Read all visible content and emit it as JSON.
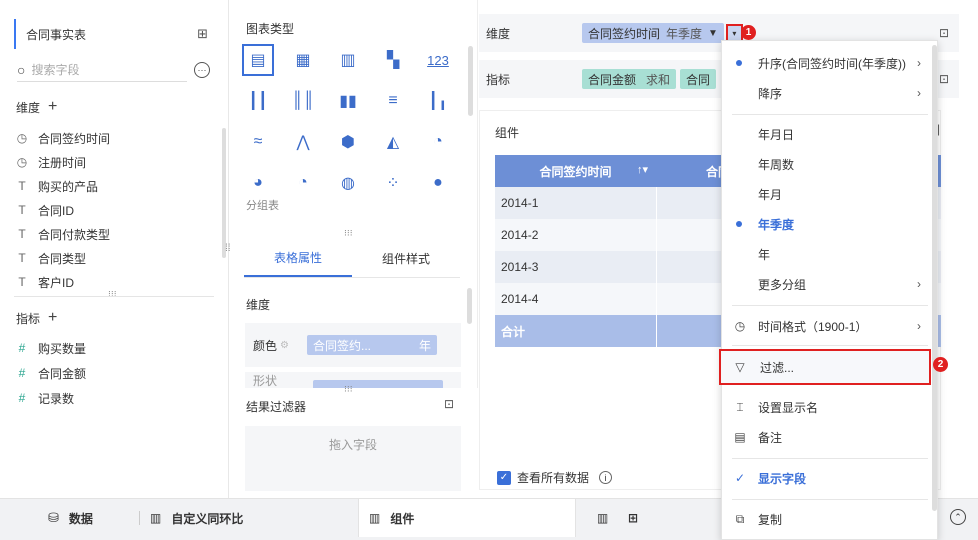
{
  "left": {
    "dataset": "合同事实表",
    "search_placeholder": "搜索字段",
    "dim_title": "维度",
    "dims": [
      {
        "icon": "clock",
        "label": "合同签约时间"
      },
      {
        "icon": "clock",
        "label": "注册时间"
      },
      {
        "icon": "text",
        "label": "购买的产品"
      },
      {
        "icon": "text",
        "label": "合同ID"
      },
      {
        "icon": "text",
        "label": "合同付款类型"
      },
      {
        "icon": "text",
        "label": "合同类型"
      },
      {
        "icon": "text",
        "label": "客户ID"
      }
    ],
    "measure_title": "指标",
    "measures": [
      {
        "label": "购买数量"
      },
      {
        "label": "合同金额"
      },
      {
        "label": "记录数"
      }
    ]
  },
  "mid": {
    "chart_type_title": "图表类型",
    "group_label": "分组表",
    "tabs": [
      "表格属性",
      "组件样式"
    ],
    "dim_label": "维度",
    "color_label": "颜色",
    "color_field": "合同签约...",
    "color_suffix": "年",
    "shape_label": "形状",
    "filter_title": "结果过滤器",
    "drop_hint": "拖入字段"
  },
  "right": {
    "dim_label": "维度",
    "dim_pill": "合同签约时间",
    "dim_pill_sub": "年季度",
    "measure_label": "指标",
    "measure_pill": "合同金额",
    "measure_pill_sub": "求和",
    "measure_pill2": "合同",
    "component_label": "组件",
    "table_header": "合同签约时间",
    "table_header2": "合同",
    "rows": [
      "2014-1",
      "2014-2",
      "2014-3",
      "2014-4"
    ],
    "total": "合计",
    "view_all": "查看所有数据"
  },
  "menu": {
    "items": {
      "asc": "升序(合同签约时间(年季度))",
      "desc": "降序",
      "ymd": "年月日",
      "yw": "年周数",
      "ym": "年月",
      "yq": "年季度",
      "y": "年",
      "more": "更多分组",
      "timefmt": "时间格式（1900-1）",
      "filter": "过滤...",
      "rename": "设置显示名",
      "note": "备注",
      "show": "显示字段",
      "copy": "复制"
    }
  },
  "bottom": {
    "tabs": [
      "数据",
      "自定义同环比",
      "组件"
    ]
  },
  "badges": [
    "1",
    "2"
  ],
  "colors": {
    "accent": "#3a6fd8",
    "header": "#6d8fd6",
    "highlight": "#e02020"
  }
}
